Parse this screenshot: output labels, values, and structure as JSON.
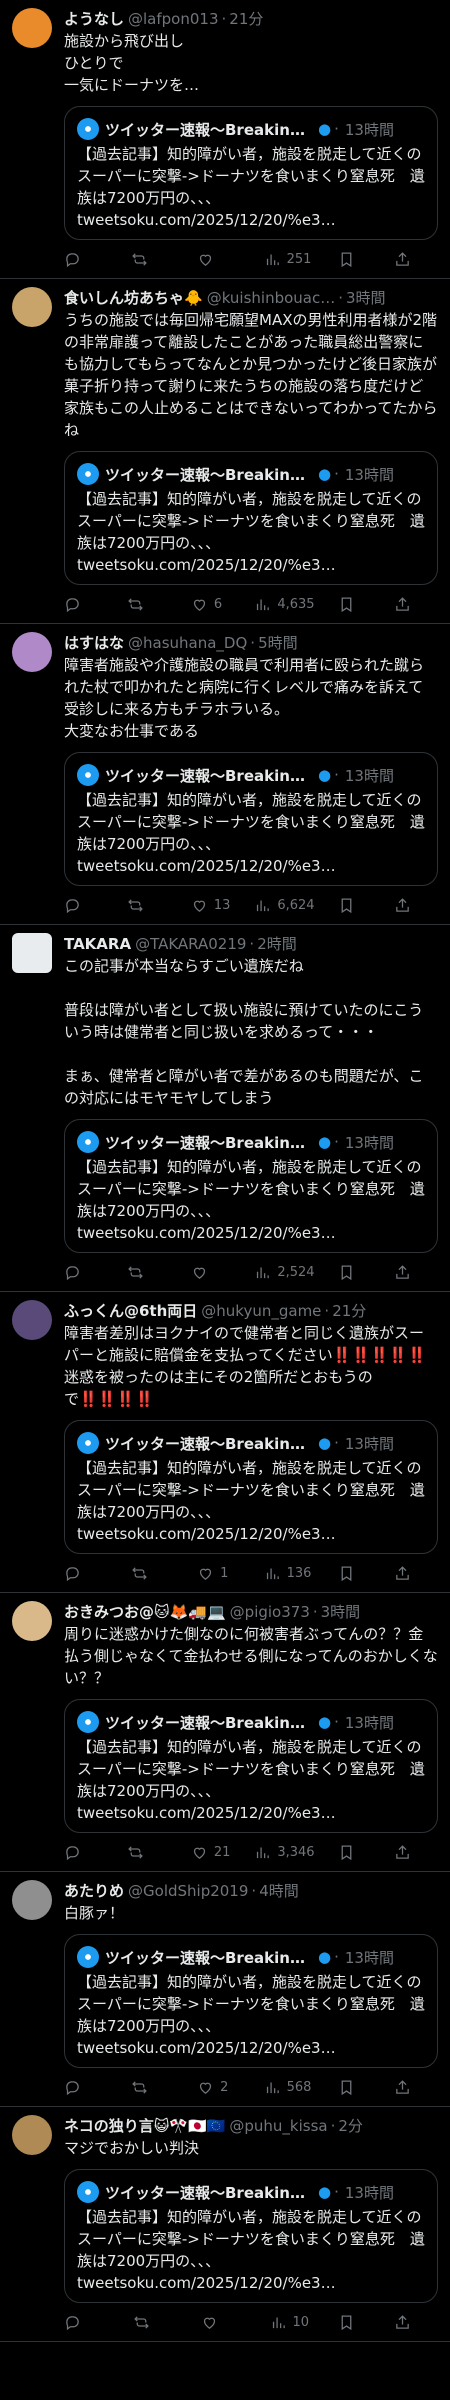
{
  "tweets": [
    {
      "name": "ようなし",
      "handle": "@lafpon013",
      "time": "21分",
      "text": "施設から飛び出し\nひとりで\n一気にドーナツを…",
      "quote_name": "ツイッター速報〜BreakingN…",
      "quote_time": "13時間",
      "quote_text": "【過去記事】知的障がい者，施設を脱走して近くのスーパーに突撃->ドーナツを食いまくり窒息死　遺族は7200万円の、、、\ntweetsoku.com/2025/12/20/%e3…",
      "replies": "",
      "retweets": "",
      "likes": "",
      "views": "251",
      "avatar_color": "#e98b2a"
    },
    {
      "name": "食いしん坊あちゃ🐥",
      "handle": "@kuishinbouac…",
      "time": "3時間",
      "text": "うちの施設では毎回帰宅願望MAXの男性利用者様が2階の非常扉護って離設したことがあった職員総出警察にも協力してもらってなんとか見つかったけど後日家族が菓子折り持って謝りに来たうちの施設の落ち度だけど家族もこの人止めることはできないってわかってたからね",
      "quote_name": "ツイッター速報〜BreakingN…",
      "quote_time": "13時間",
      "quote_text": "【過去記事】知的障がい者，施設を脱走して近くのスーパーに突撃->ドーナツを食いまくり窒息死　遺族は7200万円の、、、\ntweetsoku.com/2025/12/20/%e3…",
      "replies": "",
      "retweets": "",
      "likes": "6",
      "views": "4,635",
      "avatar_color": "#c9a46a"
    },
    {
      "name": "はすはな",
      "handle": "@hasuhana_DQ",
      "time": "5時間",
      "text": "障害者施設や介護施設の職員で利用者に殴られた蹴られた杖で叩かれたと病院に行くレベルで痛みを訴えて受診しに来る方もチラホラいる。\n大変なお仕事である",
      "quote_name": "ツイッター速報〜BreakingN…",
      "quote_time": "13時間",
      "quote_text": "【過去記事】知的障がい者，施設を脱走して近くのスーパーに突撃->ドーナツを食いまくり窒息死　遺族は7200万円の、、、\ntweetsoku.com/2025/12/20/%e3…",
      "replies": "",
      "retweets": "",
      "likes": "13",
      "views": "6,624",
      "avatar_color": "#b089c9"
    },
    {
      "name": "TAKARA",
      "handle": "@TAKARA0219",
      "time": "2時間",
      "text": "この記事が本当ならすごい遺族だね\n\n普段は障がい者として扱い施設に預けていたのにこういう時は健常者と同じ扱いを求めるって・・・\n\nまぁ、健常者と障がい者で差があるのも問題だが、この対応にはモヤモヤしてしまう",
      "quote_name": "ツイッター速報〜BreakingN…",
      "quote_time": "13時間",
      "quote_text": "【過去記事】知的障がい者，施設を脱走して近くのスーパーに突撃->ドーナツを食いまくり窒息死　遺族は7200万円の、、、\ntweetsoku.com/2025/12/20/%e3…",
      "replies": "",
      "retweets": "",
      "likes": "",
      "views": "2,524",
      "avatar_color": "#e9ecef"
    },
    {
      "name": "ふっくん@6th両日",
      "handle": "@hukyun_game",
      "time": "21分",
      "text": "障害者差別はヨクナイので健常者と同じく遺族がスーパーと施設に賠償金を支払ってください‼️‼️‼️‼️‼️\n迷惑を被ったのは主にその2箇所だとおもうので‼️‼️‼️‼️",
      "quote_name": "ツイッター速報〜BreakingN…",
      "quote_time": "13時間",
      "quote_text": "【過去記事】知的障がい者，施設を脱走して近くのスーパーに突撃->ドーナツを食いまくり窒息死　遺族は7200万円の、、、\ntweetsoku.com/2025/12/20/%e3…",
      "replies": "",
      "retweets": "",
      "likes": "1",
      "views": "136",
      "avatar_color": "#5a4a7a"
    },
    {
      "name": "おきみつお@🐱🦊🚚💻",
      "handle": "@pigio373",
      "time": "3時間",
      "text": "周りに迷惑かけた側なのに何被害者ぶってんの？？金払う側じゃなくて金払わせる側になってんのおかしくない？？",
      "quote_name": "ツイッター速報〜BreakingN…",
      "quote_time": "13時間",
      "quote_text": "【過去記事】知的障がい者，施設を脱走して近くのスーパーに突撃->ドーナツを食いまくり窒息死　遺族は7200万円の、、、\ntweetsoku.com/2025/12/20/%e3…",
      "replies": "",
      "retweets": "",
      "likes": "21",
      "views": "3,346",
      "avatar_color": "#d9b98a"
    },
    {
      "name": "あたりめ",
      "handle": "@GoldShip2019",
      "time": "4時間",
      "text": "白豚ァ！",
      "quote_name": "ツイッター速報〜BreakingN…",
      "quote_time": "13時間",
      "quote_text": "【過去記事】知的障がい者，施設を脱走して近くのスーパーに突撃->ドーナツを食いまくり窒息死　遺族は7200万円の、、、\ntweetsoku.com/2025/12/20/%e3…",
      "replies": "",
      "retweets": "",
      "likes": "2",
      "views": "568",
      "avatar_color": "#8f8f8f"
    },
    {
      "name": "ネコの独り言😺🎌🇯🇵🇪🇺",
      "handle": "@puhu_kissa",
      "time": "2分",
      "text": "マジでおかしい判決",
      "quote_name": "ツイッター速報〜BreakingN…",
      "quote_time": "13時間",
      "quote_text": "【過去記事】知的障がい者，施設を脱走して近くのスーパーに突撃->ドーナツを食いまくり窒息死　遺族は7200万円の、、、\ntweetsoku.com/2025/12/20/%e3…",
      "replies": "",
      "retweets": "",
      "likes": "",
      "views": "10",
      "avatar_color": "#b08a55"
    }
  ]
}
